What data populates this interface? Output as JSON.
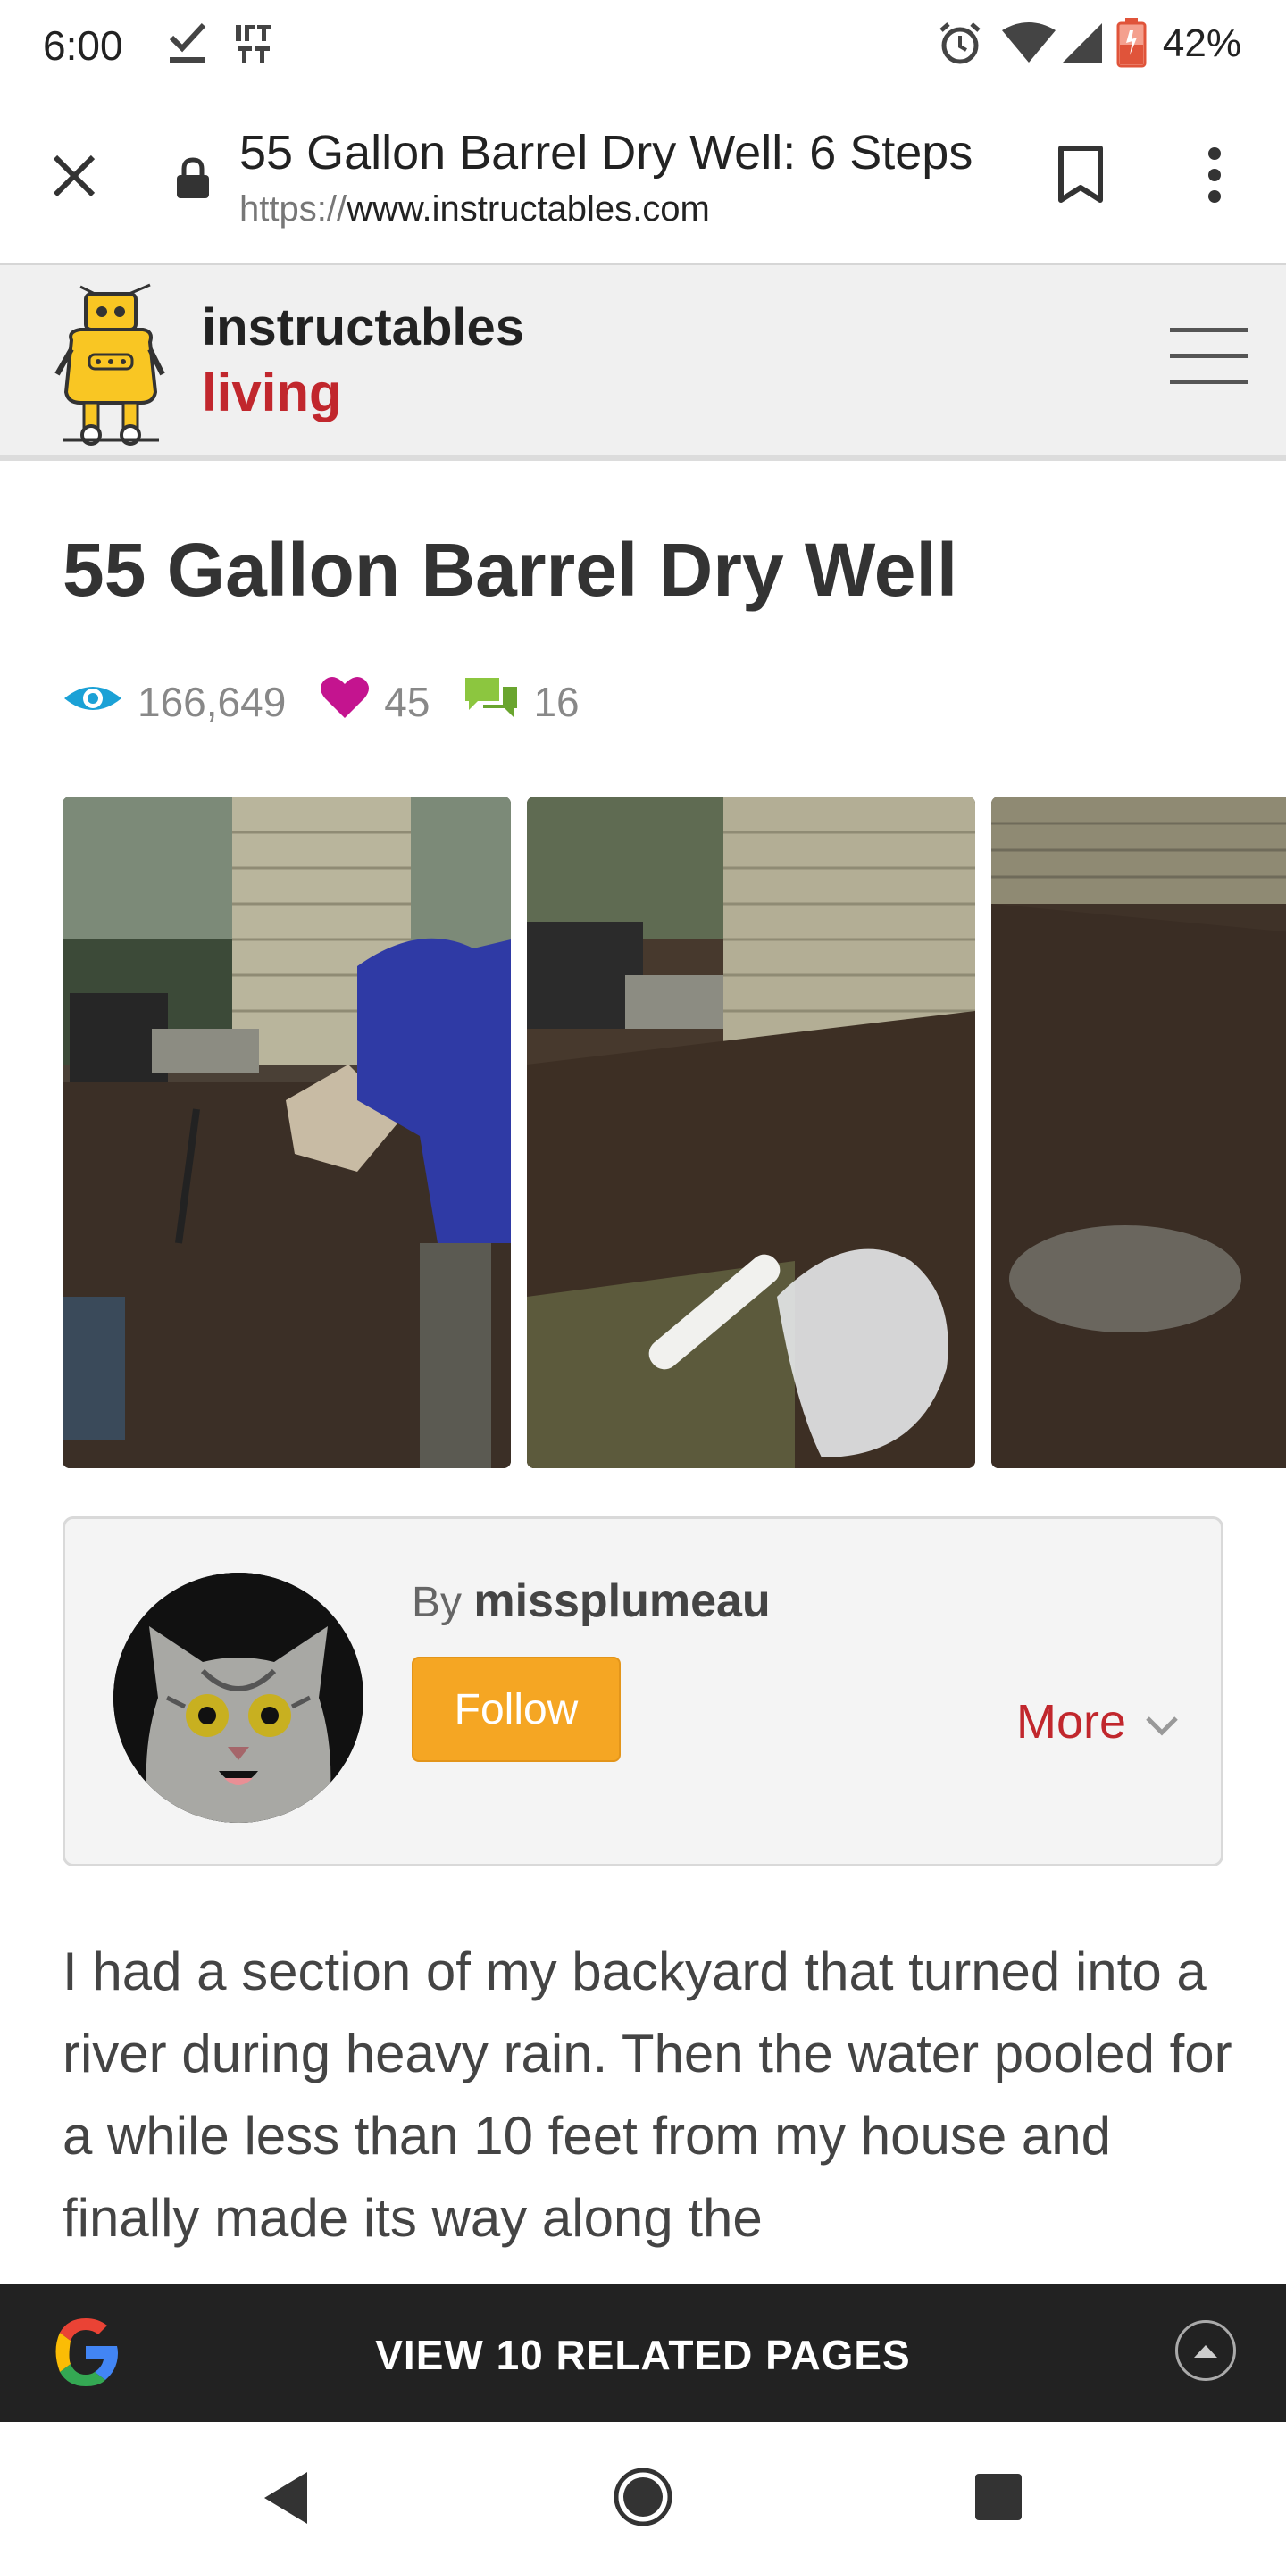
{
  "status_bar": {
    "time": "6:00",
    "battery": "42%",
    "icons": [
      "download-done-icon",
      "ifttt-icon",
      "alarm-icon",
      "wifi-icon",
      "signal-icon",
      "battery-icon"
    ]
  },
  "browser": {
    "page_title": "55 Gallon Barrel Dry Well: 6 Steps",
    "url_protocol": "https://",
    "url_host": "www.instructables.com",
    "icons": [
      "close-icon",
      "lock-icon",
      "bookmark-icon",
      "more-vert-icon"
    ]
  },
  "site_header": {
    "brand": "instructables",
    "channel": "living",
    "icons": [
      "robot-logo",
      "menu-icon"
    ]
  },
  "article": {
    "title": "55 Gallon Barrel Dry Well",
    "views": "166,649",
    "favorites": "45",
    "comments": "16"
  },
  "author": {
    "by_label": "By",
    "username": "missplumeau",
    "follow_label": "Follow",
    "more_label": "More"
  },
  "body": {
    "intro": "I had a section of my backyard that turned into a river during heavy rain. Then the water pooled for a while less than 10 feet from my house and finally made its way along the"
  },
  "related_bar": {
    "label": "VIEW 10 RELATED PAGES"
  },
  "colors": {
    "accent_red": "#c1272d",
    "follow_orange": "#f5a623",
    "views_blue": "#1ba1d6",
    "heart_magenta": "#c4148f",
    "comment_green": "#8cc63f"
  }
}
